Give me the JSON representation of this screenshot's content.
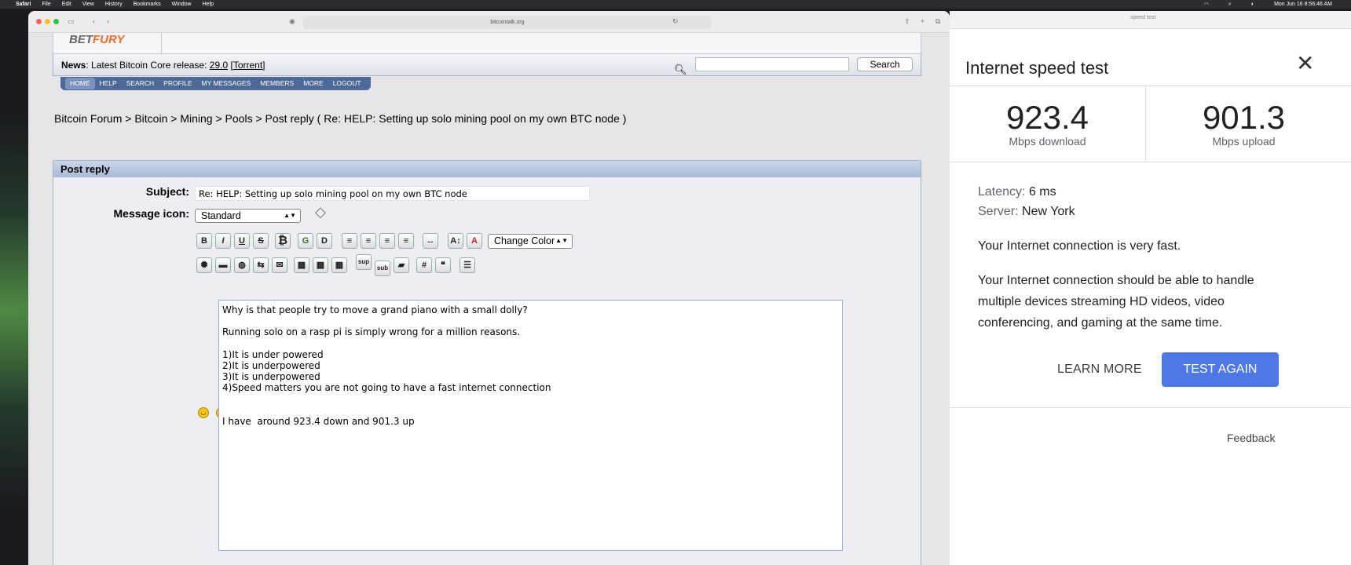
{
  "menubar": {
    "app": "Safari",
    "items": [
      "File",
      "Edit",
      "View",
      "History",
      "Bookmarks",
      "Window",
      "Help"
    ],
    "clock": "Mon Jun 16  8:56:46 AM"
  },
  "safari": {
    "url": "bitcointalk.org"
  },
  "forum": {
    "logo_a": "BET",
    "logo_b": "FURY",
    "news_label": "News",
    "news_text": ": Latest Bitcoin Core release: ",
    "news_version": "29.0",
    "news_torrent": "Torrent",
    "search_button": "Search",
    "nav": [
      "HOME",
      "HELP",
      "SEARCH",
      "PROFILE",
      "MY MESSAGES",
      "MEMBERS",
      "MORE",
      "LOGOUT"
    ],
    "breadcrumb": [
      "Bitcoin Forum",
      "Bitcoin",
      "Mining",
      "Pools",
      "Post reply ( Re: HELP: Setting up solo mining pool on my own BTC node )"
    ],
    "post_header": "Post reply",
    "subject_label": "Subject:",
    "subject_value": "Re: HELP: Setting up solo mining pool on my own BTC node",
    "icon_label": "Message icon:",
    "icon_value": "Standard",
    "change_color": "Change Color",
    "message": "Why is that people try to move a grand piano with a small dolly?\n\nRunning solo on a rasp pi is simply wrong for a million reasons.\n\n1)It is under powered\n2)It is underpowered\n3)It is underpowered\n4)Speed matters you are not going to have a fast internet connection\n\n\nI have  around 923.4 down and 901.3 up"
  },
  "speedtest": {
    "search_placeholder": "speed test",
    "title": "Internet speed test",
    "download_value": "923.4",
    "download_unit": "Mbps download",
    "upload_value": "901.3",
    "upload_unit": "Mbps upload",
    "latency_label": "Latency:",
    "latency_value": "6 ms",
    "server_label": "Server:",
    "server_value": "New York",
    "summary": "Your Internet connection is very fast.",
    "detail_1": "Your Internet connection should be able to handle",
    "detail_2": "multiple devices streaming HD videos, video",
    "detail_3": "conferencing, and gaming at the same time.",
    "learn_more": "LEARN MORE",
    "test_again": "TEST AGAIN",
    "feedback": "Feedback"
  }
}
